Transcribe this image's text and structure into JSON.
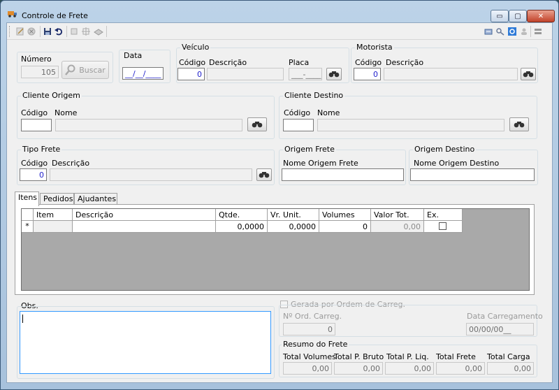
{
  "window": {
    "title": "Controle de Frete",
    "buttons": {
      "minimize": "▭",
      "maximize": "▢",
      "close": "✕"
    }
  },
  "toolbar": {
    "left_icons": [
      "new-icon",
      "delete-icon",
      "save-icon",
      "undo-icon",
      "first-icon",
      "expand-icon",
      "print-icon"
    ],
    "right_icons": [
      "report-icon",
      "key-icon",
      "refresh-icon",
      "user-icon",
      "exit-icon"
    ]
  },
  "numero": {
    "label": "Número",
    "value": "105",
    "buscar_label": "Buscar"
  },
  "data": {
    "label": "Data",
    "value": "__/__/____"
  },
  "veiculo": {
    "title": "Veículo",
    "codigo_label": "Código",
    "codigo_value": "0",
    "descricao_label": "Descrição",
    "descricao_value": "",
    "placa_label": "Placa",
    "placa_value": "___-____"
  },
  "motorista": {
    "title": "Motorista",
    "codigo_label": "Código",
    "codigo_value": "0",
    "descricao_label": "Descrição",
    "descricao_value": ""
  },
  "cliente_origem": {
    "title": "Cliente Origem",
    "codigo_label": "Código",
    "codigo_value": "",
    "nome_label": "Nome",
    "nome_value": ""
  },
  "cliente_destino": {
    "title": "Cliente Destino",
    "codigo_label": "Código",
    "codigo_value": "",
    "nome_label": "Nome",
    "nome_value": ""
  },
  "tipo_frete": {
    "title": "Tipo Frete",
    "codigo_label": "Código",
    "codigo_value": "0",
    "descricao_label": "Descrição",
    "descricao_value": ""
  },
  "origem_frete": {
    "title": "Origem Frete",
    "nome_label": "Nome Origem Frete",
    "nome_value": ""
  },
  "origem_destino": {
    "title": "Origem Destino",
    "nome_label": "Nome Origem Destino",
    "nome_value": ""
  },
  "tabs": [
    {
      "label": "Itens"
    },
    {
      "label": "Pedidos"
    },
    {
      "label": "Ajudantes"
    }
  ],
  "grid": {
    "columns": [
      "Item",
      "Descrição",
      "Qtde.",
      "Vr. Unit.",
      "Volumes",
      "Valor Tot.",
      "Ex."
    ],
    "row": {
      "marker": "*",
      "item": "",
      "descricao": "",
      "qtde": "0,0000",
      "vr_unit": "0,0000",
      "volumes": "0",
      "valor_tot": "0,00",
      "ex": false
    }
  },
  "obs": {
    "label": "Obs.",
    "value": ""
  },
  "ordem_carreg": {
    "checkbox_label": "Gerada por Ordem de Carreg.",
    "checked": false,
    "num_label": "Nº Ord. Carreg.",
    "num_value": "0",
    "data_label": "Data Carregamento",
    "data_value": "00/00/00__"
  },
  "resumo": {
    "title": "Resumo do Frete",
    "fields": [
      {
        "label": "Total Volumes",
        "value": "0,00"
      },
      {
        "label": "Total P. Bruto",
        "value": "0,00"
      },
      {
        "label": "Total P. Liq.",
        "value": "0,00"
      },
      {
        "label": "Total Frete",
        "value": "0,00"
      },
      {
        "label": "Total Carga",
        "value": "0,00"
      }
    ]
  },
  "colors": {
    "accent": "#3399ff",
    "grid_background": "#a9a9a9",
    "window_frame": "#bcd3e8"
  }
}
